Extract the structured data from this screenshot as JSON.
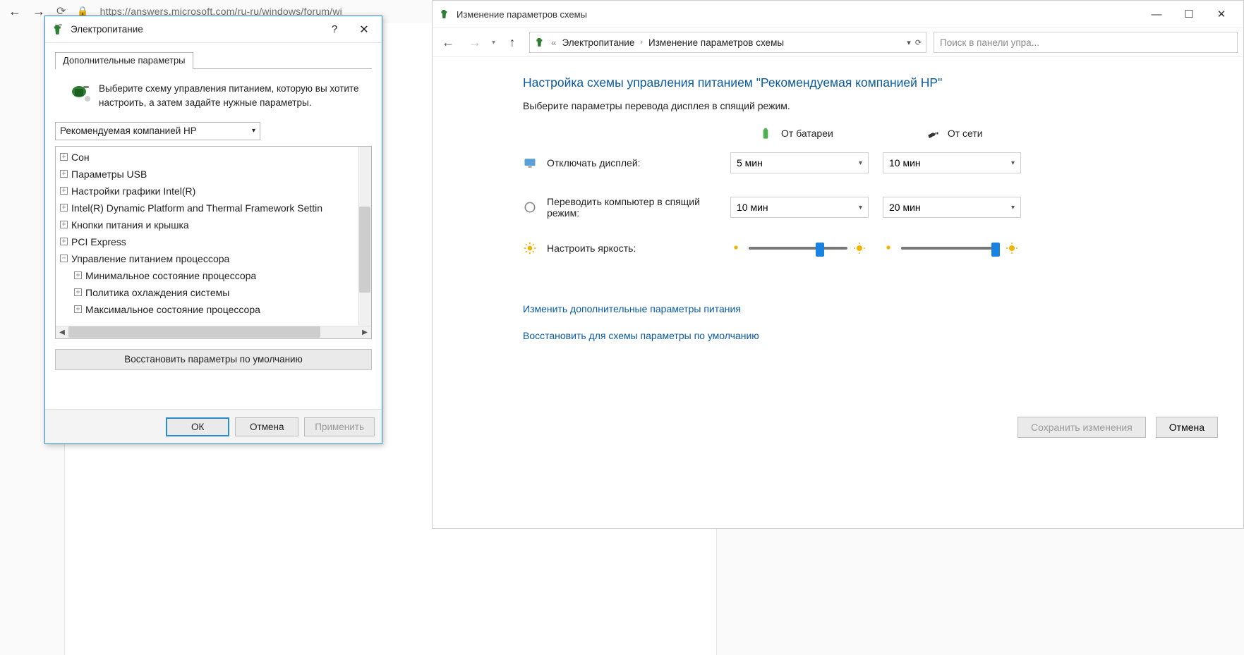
{
  "browser": {
    "url": "https://answers.microsoft.com/ru-ru/windows/forum/wi"
  },
  "dialog": {
    "title": "Электропитание",
    "tab": "Дополнительные параметры",
    "intro": "Выберите схему управления питанием, которую вы хотите настроить, а затем задайте нужные параметры.",
    "scheme": "Рекомендуемая компанией HP",
    "tree": [
      {
        "pm": "+",
        "label": "Сон",
        "indent": 0
      },
      {
        "pm": "+",
        "label": "Параметры USB",
        "indent": 0
      },
      {
        "pm": "+",
        "label": "Настройки графики Intel(R)",
        "indent": 0
      },
      {
        "pm": "+",
        "label": "Intel(R) Dynamic Platform and Thermal Framework Settin",
        "indent": 0
      },
      {
        "pm": "+",
        "label": "Кнопки питания и крышка",
        "indent": 0
      },
      {
        "pm": "+",
        "label": "PCI Express",
        "indent": 0
      },
      {
        "pm": "−",
        "label": "Управление питанием процессора",
        "indent": 0
      },
      {
        "pm": "+",
        "label": "Минимальное состояние процессора",
        "indent": 1
      },
      {
        "pm": "+",
        "label": "Политика охлаждения системы",
        "indent": 1
      },
      {
        "pm": "+",
        "label": "Максимальное состояние процессора",
        "indent": 1
      }
    ],
    "restore": "Восстановить параметры по умолчанию",
    "ok": "ОК",
    "cancel": "Отмена",
    "apply": "Применить"
  },
  "explorer": {
    "title": "Изменение параметров схемы",
    "crumb1": "Электропитание",
    "crumb2": "Изменение параметров схемы",
    "search_placeholder": "Поиск в панели упра...",
    "heading": "Настройка схемы управления питанием \"Рекомендуемая компанией HP\"",
    "sub": "Выберите параметры перевода дисплея в спящий режим.",
    "src_battery": "От батареи",
    "src_ac": "От сети",
    "row1_label": "Отключать дисплей:",
    "row1_battery": "5 мин",
    "row1_ac": "10 мин",
    "row2_label": "Переводить компьютер в спящий режим:",
    "row2_battery": "10 мин",
    "row2_ac": "20 мин",
    "row3_label": "Настроить яркость:",
    "link1": "Изменить дополнительные параметры питания",
    "link2": "Восстановить для схемы параметры по умолчанию",
    "save": "Сохранить изменения",
    "cancel": "Отмена"
  }
}
